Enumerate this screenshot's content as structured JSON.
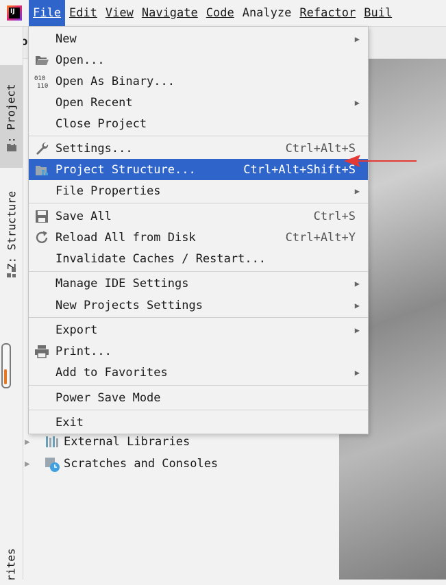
{
  "menubar": {
    "items": [
      {
        "label": "File",
        "active": true
      },
      {
        "label": "Edit"
      },
      {
        "label": "View"
      },
      {
        "label": "Navigate"
      },
      {
        "label": "Code"
      },
      {
        "label": "Analyze"
      },
      {
        "label": "Refactor"
      },
      {
        "label": "Buil"
      }
    ]
  },
  "navbar": {
    "text": "to"
  },
  "toolstrip": {
    "project_tab": "1: Project",
    "structure_tab": "Z: Structure",
    "favorites_tab": "rites"
  },
  "file_menu": {
    "items": [
      {
        "label": "New",
        "submenu": true,
        "icon": "none"
      },
      {
        "label": "Open...",
        "icon": "folder-open-icon"
      },
      {
        "label": "Open As Binary...",
        "icon": "binary-icon"
      },
      {
        "label": "Open Recent",
        "submenu": true
      },
      {
        "label": "Close Project"
      },
      {
        "label": "Settings...",
        "shortcut": "Ctrl+Alt+S",
        "icon": "wrench-icon"
      },
      {
        "label": "Project Structure...",
        "shortcut": "Ctrl+Alt+Shift+S",
        "icon": "project-structure-icon",
        "selected": true
      },
      {
        "label": "File Properties",
        "submenu": true
      },
      {
        "label": "Save All",
        "shortcut": "Ctrl+S",
        "icon": "save-icon"
      },
      {
        "label": "Reload All from Disk",
        "shortcut": "Ctrl+Alt+Y",
        "icon": "reload-icon"
      },
      {
        "label": "Invalidate Caches / Restart..."
      },
      {
        "label": "Manage IDE Settings",
        "submenu": true
      },
      {
        "label": "New Projects Settings",
        "submenu": true
      },
      {
        "label": "Export",
        "submenu": true
      },
      {
        "label": "Print...",
        "icon": "printer-icon"
      },
      {
        "label": "Add to Favorites",
        "submenu": true
      },
      {
        "label": "Power Save Mode"
      },
      {
        "label": "Exit"
      }
    ]
  },
  "project_tree": {
    "items": [
      {
        "label": "External Libraries",
        "icon": "libraries-icon"
      },
      {
        "label": "Scratches and Consoles",
        "icon": "scratches-icon"
      }
    ]
  },
  "colors": {
    "selection": "#2f65ca",
    "annotation": "#e53935"
  }
}
